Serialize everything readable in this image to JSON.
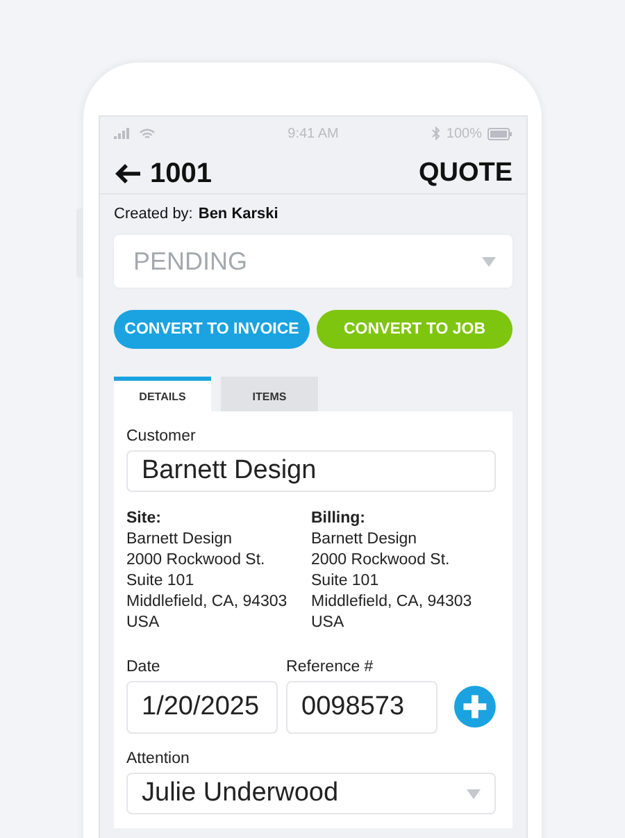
{
  "status_bar": {
    "time": "9:41 AM",
    "battery": "100%"
  },
  "header": {
    "number": "1001",
    "type": "QUOTE"
  },
  "created_by": {
    "label": "Created by:",
    "name": "Ben Karski"
  },
  "status_select": {
    "value": "PENDING"
  },
  "buttons": [
    {
      "label": "CONVERT TO INVOICE",
      "color": "#1aa3e0"
    },
    {
      "label": "CONVERT TO JOB",
      "color": "#7ec50f"
    }
  ],
  "tabs": [
    {
      "label": "DETAILS",
      "selected": true
    },
    {
      "label": "ITEMS",
      "selected": false
    }
  ],
  "customer": {
    "label": "Customer",
    "value": "Barnett Design"
  },
  "addresses": [
    {
      "heading": "Site:",
      "lines": [
        "Barnett Design",
        "2000 Rockwood St.",
        "Suite 101",
        "Middlefield, CA, 94303",
        "USA"
      ]
    },
    {
      "heading": "Billing:",
      "lines": [
        "Barnett Design",
        "2000 Rockwood St.",
        "Suite 101",
        "Middlefield, CA, 94303",
        "USA"
      ]
    }
  ],
  "date": {
    "label": "Date",
    "value": "1/20/2025"
  },
  "reference": {
    "label": "Reference #",
    "value": "0098573"
  },
  "attention": {
    "label": "Attention",
    "value": "Julie Underwood"
  }
}
